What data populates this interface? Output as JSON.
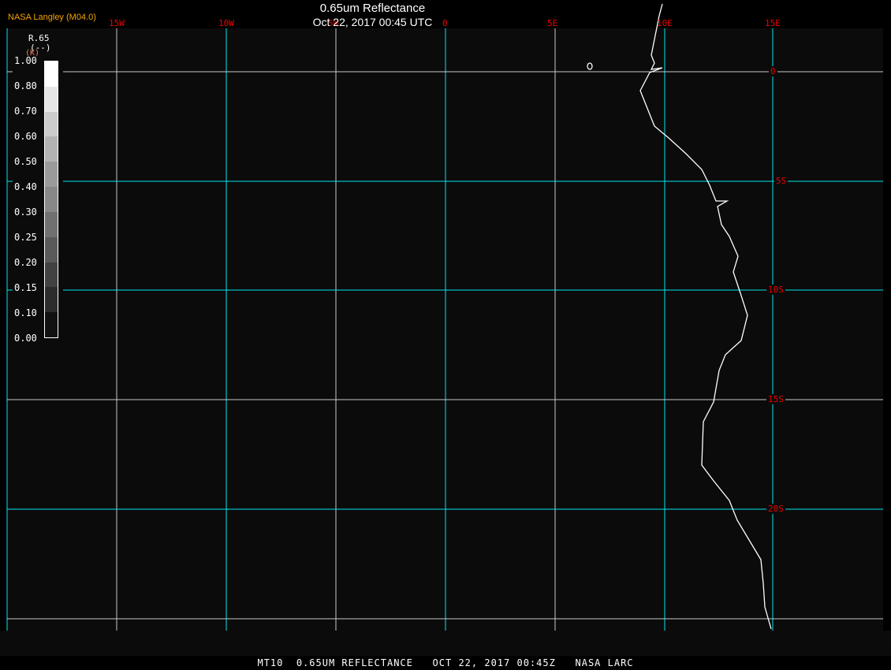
{
  "header": {
    "title": "0.65um Reflectance",
    "datetime": "Oct 22, 2017 00:45 UTC",
    "brand": "NASA Langley (M04.0)"
  },
  "lon_labels": [
    "15W",
    "10W",
    "5W",
    "0",
    "5E",
    "10E",
    "15E"
  ],
  "lat_labels": [
    "0",
    "5S",
    "10S",
    "15S",
    "20S"
  ],
  "legend": {
    "variable": "R.65",
    "units": "(--)",
    "marker": "(K)",
    "ticks": [
      "1.00",
      "0.80",
      "0.70",
      "0.60",
      "0.50",
      "0.40",
      "0.30",
      "0.25",
      "0.20",
      "0.15",
      "0.10",
      "0.00"
    ],
    "colors": [
      "#ffffff",
      "#e6e6e6",
      "#cccccc",
      "#b3b3b3",
      "#9a9a9a",
      "#888888",
      "#707070",
      "#5a5a5a",
      "#424242",
      "#2c2c2c",
      "#111111"
    ]
  },
  "colors": {
    "grid_primary": "#00e5ee",
    "grid_secondary": "#c8c8c8",
    "labels": "#ee0000",
    "coastline": "#ffffff"
  },
  "footer": "MT10  0.65UM REFLECTANCE   OCT 22, 2017 00:45Z   NASA LARC"
}
